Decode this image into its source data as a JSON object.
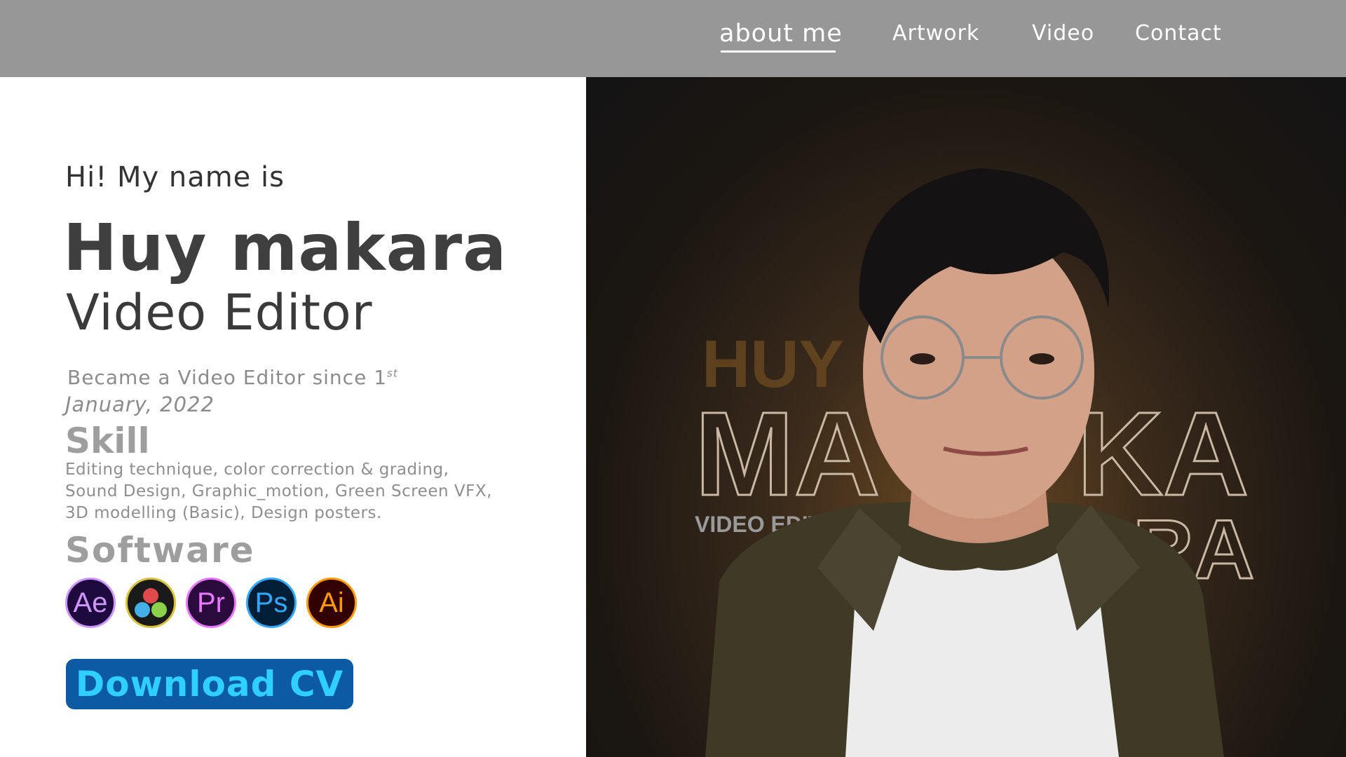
{
  "nav": {
    "items": [
      {
        "label": "about me",
        "active": true
      },
      {
        "label": "Artwork",
        "active": false
      },
      {
        "label": "Video",
        "active": false
      },
      {
        "label": "Contact",
        "active": false
      }
    ]
  },
  "hero": {
    "greeting": "Hi! My name is",
    "name": "Huy makara",
    "role": "Video Editor",
    "since_text": "Became a Video Editor since 1",
    "since_sup": "st",
    "since_date": "January, 2022"
  },
  "skill": {
    "heading": "Skill",
    "line1": "Editing technique, color correction & grading,",
    "line2": "Sound Design, Graphic_motion, Green Screen VFX,",
    "line3": "3D modelling (Basic), Design posters."
  },
  "software": {
    "heading": "Software",
    "icons": [
      {
        "name": "after-effects-icon",
        "label": "Ae",
        "color": "#cf96fd"
      },
      {
        "name": "davinci-resolve-icon",
        "label": "",
        "color": "#d9c23a"
      },
      {
        "name": "premiere-pro-icon",
        "label": "Pr",
        "color": "#ea77ff"
      },
      {
        "name": "photoshop-icon",
        "label": "Ps",
        "color": "#31a8ff"
      },
      {
        "name": "illustrator-icon",
        "label": "Ai",
        "color": "#ff9a00"
      }
    ]
  },
  "cta": {
    "download_label": "Download CV"
  },
  "photo": {
    "bg_text_top": "HUY",
    "bg_text_ma": "MA",
    "bg_text_ka": "KA",
    "bg_text_ra": "RA",
    "bg_text_sub": "VIDEO EDITOR"
  },
  "colors": {
    "topbar": "#979797",
    "button_bg": "#0b5aa2",
    "button_text": "#2fd0ff"
  }
}
